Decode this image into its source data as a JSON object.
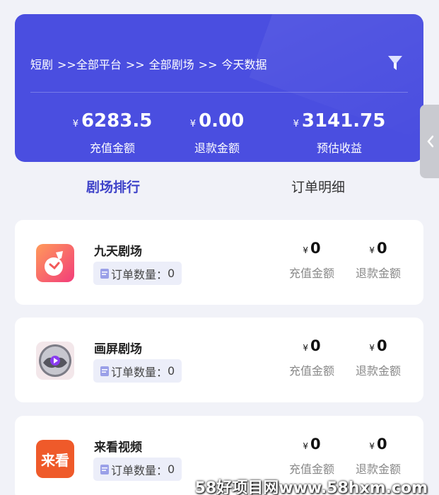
{
  "header": {
    "breadcrumb": [
      "短剧",
      ">>全部平台",
      ">>",
      "全部剧场",
      ">>",
      "今天数据"
    ],
    "stats": [
      {
        "currency": "¥",
        "value": "6283.5",
        "label": "充值金额"
      },
      {
        "currency": "¥",
        "value": "0.00",
        "label": "退款金额"
      },
      {
        "currency": "¥",
        "value": "3141.75",
        "label": "预估收益"
      }
    ]
  },
  "tabs": [
    {
      "label": "剧场排行",
      "active": true
    },
    {
      "label": "订单明细",
      "active": false
    }
  ],
  "theaters": [
    {
      "name": "九天剧场",
      "order_label": "订单数量：",
      "order_count": "0",
      "recharge": {
        "currency": "¥",
        "value": "0",
        "label": "充值金额"
      },
      "refund": {
        "currency": "¥",
        "value": "0",
        "label": "退款金额"
      }
    },
    {
      "name": "画屏剧场",
      "order_label": "订单数量：",
      "order_count": "0",
      "recharge": {
        "currency": "¥",
        "value": "0",
        "label": "充值金额"
      },
      "refund": {
        "currency": "¥",
        "value": "0",
        "label": "退款金额"
      }
    },
    {
      "name": "来看视频",
      "logo_text": "来看",
      "order_label": "订单数量：",
      "order_count": "0",
      "recharge": {
        "currency": "¥",
        "value": "0",
        "label": "充值金额"
      },
      "refund": {
        "currency": "¥",
        "value": "0",
        "label": "退款金额"
      }
    }
  ],
  "watermark": "58好项目网www.58hxm.com",
  "colors": {
    "primary": "#4a4ee0",
    "tab_active": "#3f43c9",
    "badge_bg": "#eceef9"
  }
}
